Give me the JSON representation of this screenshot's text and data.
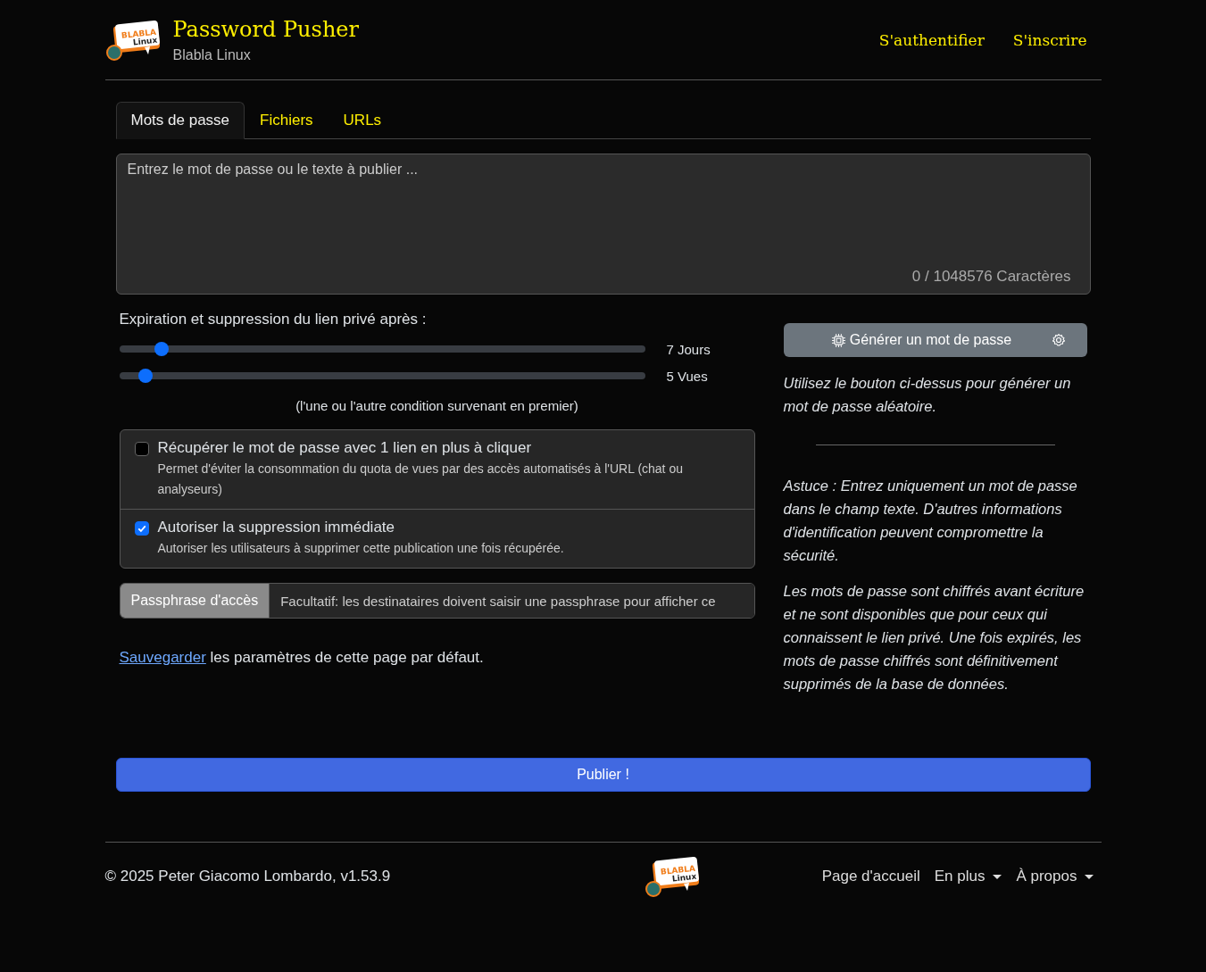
{
  "header": {
    "logo": {
      "word": "BLABLA",
      "sub": "Linux"
    },
    "title": "Password Pusher",
    "subtitle": "Blabla Linux",
    "nav": [
      "S'authentifier",
      "S'inscrire"
    ]
  },
  "tabs": [
    {
      "label": "Mots de passe",
      "selected": true
    },
    {
      "label": "Fichiers",
      "selected": false
    },
    {
      "label": "URLs",
      "selected": false
    }
  ],
  "textarea": {
    "placeholder": "Entrez le mot de passe ou le texte à publier ...",
    "counter": "0 / 1048576 Caractères"
  },
  "expiration": {
    "label": "Expiration et suppression du lien privé après :",
    "sliders": [
      {
        "level": 0.08,
        "reading": "7 Jours"
      },
      {
        "level": 0.05,
        "reading": "5 Vues"
      }
    ],
    "note": "(l'une ou l'autre condition survenant en premier)"
  },
  "options": [
    {
      "label": "Récupérer le mot de passe avec 1 lien en plus à cliquer",
      "help": "Permet d'éviter la consommation du quota de vues par des accès automatisés à l'URL (chat ou analyseurs)",
      "checked": false
    },
    {
      "label": "Autoriser la suppression immédiate",
      "help": "Autoriser les utilisateurs à supprimer cette publication une fois récupérée.",
      "checked": true
    }
  ],
  "passphrase": {
    "label": "Passphrase d'accès",
    "placeholder": "Facultatif: les destinataires doivent saisir une passphrase pour afficher ce"
  },
  "save": {
    "link": "Sauvegarder",
    "text": "les paramètres de cette page par défaut."
  },
  "generator": {
    "button": "Générer un mot de passe",
    "tip": "Utilisez le bouton ci-dessus pour générer un mot de passe aléatoire."
  },
  "notes": [
    "Astuce : Entrez uniquement un mot de passe dans le champ texte. D'autres informations d'identification peuvent compromettre la sécurité.",
    "Les mots de passe sont chiffrés avant écriture et ne sont disponibles que pour ceux qui connaissent le lien privé. Une fois expirés, les mots de passe chiffrés sont définitivement supprimés de la base de données."
  ],
  "submit": "Publier !",
  "footer": {
    "copyright": "© 2025 Peter Giacomo Lombardo, v1.53.9",
    "logo": {
      "word": "BLABLA",
      "sub": "Linux"
    },
    "links": [
      {
        "label": "Page d'accueil",
        "dropdown": false
      },
      {
        "label": "En plus",
        "dropdown": true
      },
      {
        "label": "À propos",
        "dropdown": true
      }
    ]
  }
}
